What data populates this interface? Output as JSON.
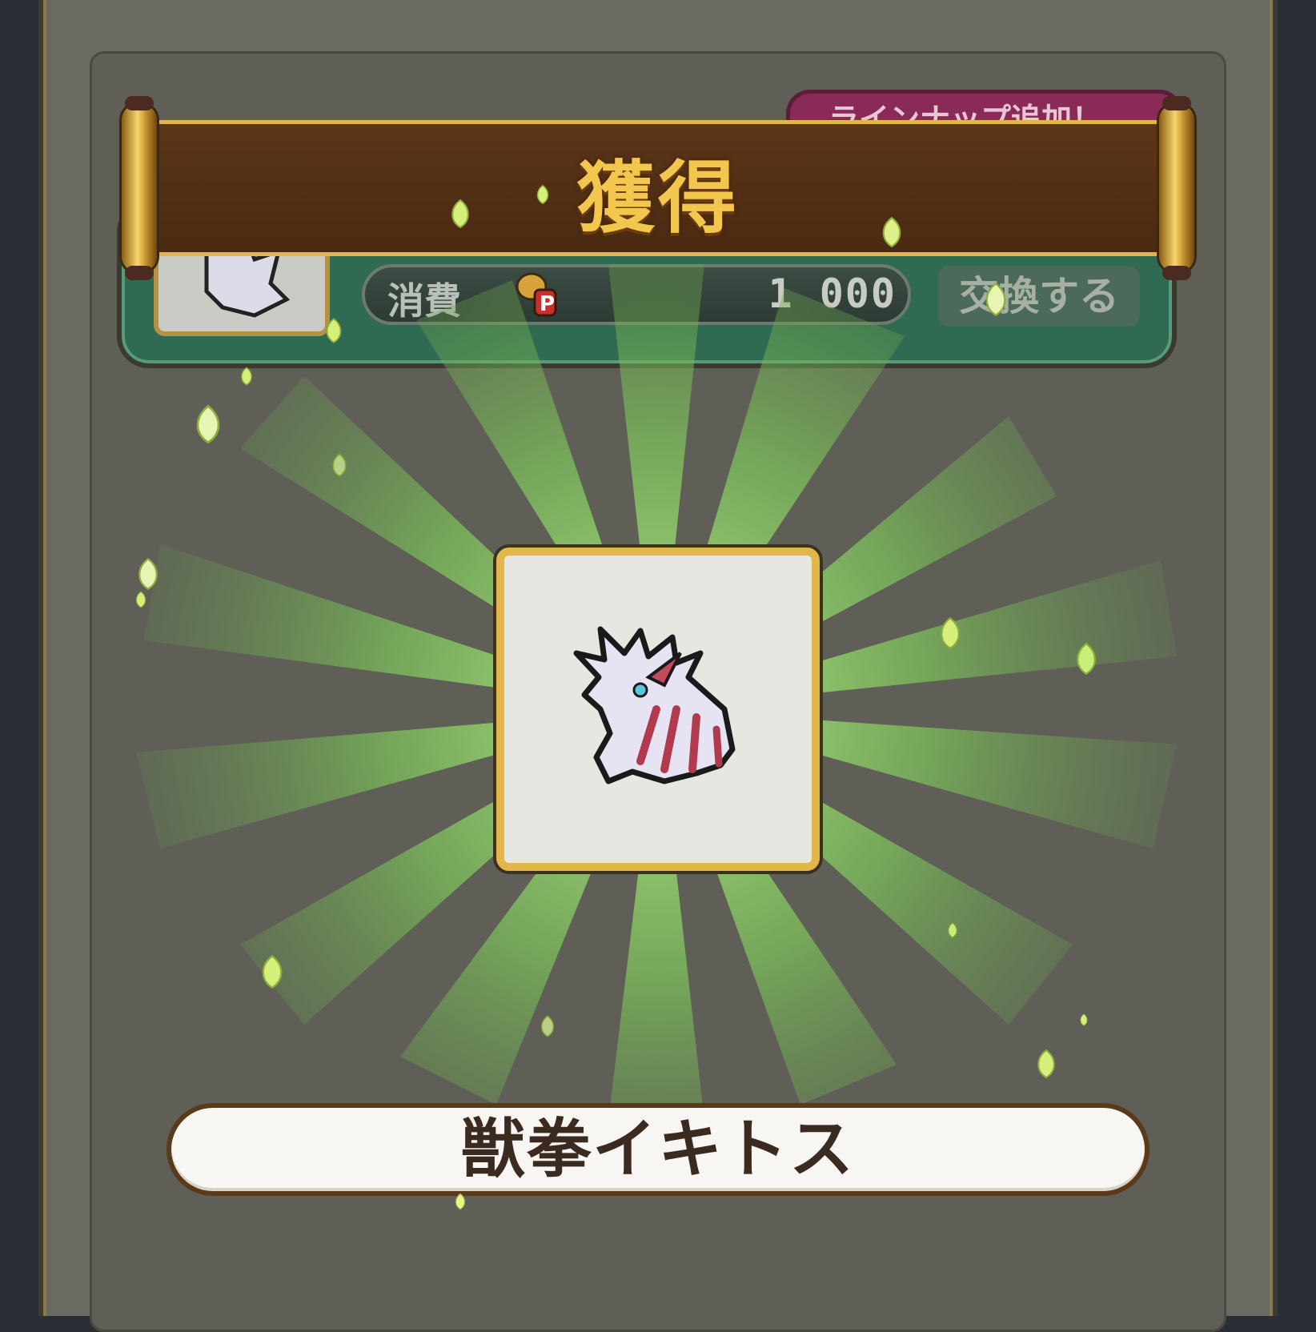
{
  "banner": {
    "title": "獲得"
  },
  "lineup_tag": {
    "label": "ラインナップ追加！"
  },
  "exchange": {
    "cost_label": "消費",
    "cost_icon": "p-point-icon",
    "cost_value": "1 000",
    "button_label": "交換する"
  },
  "reward": {
    "icon": "beast-fist-claw-icon",
    "name": "獣拳イキトス"
  },
  "colors": {
    "burst_green": "#8ed46a",
    "banner_brown": "#4a2a12",
    "gold": "#e3b64c",
    "card_green": "#2f6a52"
  }
}
